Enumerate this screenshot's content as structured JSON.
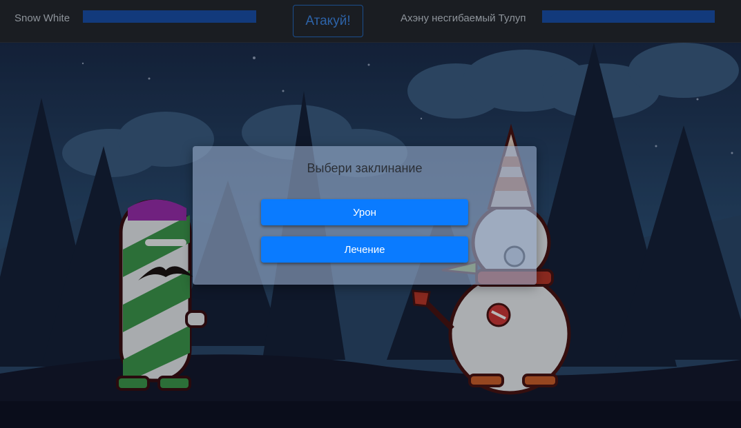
{
  "hud": {
    "player_left": {
      "name": "Snow White",
      "hp_fraction": 1.0
    },
    "attack_label": "Атакуй!",
    "player_right": {
      "name": "Ахэну несгибаемый Тулуп",
      "hp_fraction": 1.0
    }
  },
  "modal": {
    "title": "Выбери заклинание",
    "damage_label": "Урон",
    "heal_label": "Лечение"
  },
  "colors": {
    "accent": "#0a7bff",
    "hud_bg": "#1a1d22",
    "hp_bar": "#123a7c"
  },
  "icons": {
    "left_character": "candy-cane-character-icon",
    "right_character": "snowman-character-icon"
  }
}
